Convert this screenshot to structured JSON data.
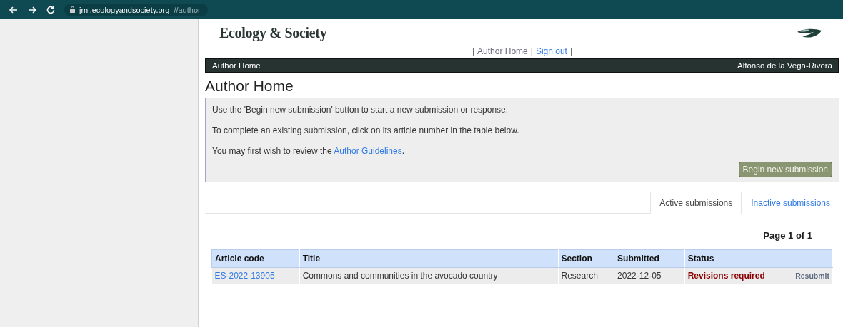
{
  "browser": {
    "url_host": "jrnl.ecologyandsociety.org",
    "url_path": "//author"
  },
  "header": {
    "logo": "Ecology & Society"
  },
  "top_links": {
    "items": [
      {
        "label": "Author Home",
        "selected": true
      },
      {
        "label": "Sign out",
        "selected": false
      }
    ],
    "separator": "|"
  },
  "nav_bar": {
    "left": "Author Home",
    "right": "Alfonso de la Vega-Rivera"
  },
  "page_title": "Author Home",
  "info_box": {
    "lines": [
      {
        "text": "Use the 'Begin new submission' button to start a new submission or response."
      },
      {
        "text": "To complete an existing submission, click on its article number in the table below."
      },
      {
        "text": "You may first wish to review the ",
        "link": "Author Guidelines",
        "after": "."
      }
    ],
    "button": "Begin new submission"
  },
  "tabs": [
    {
      "label": "Active submissions",
      "selected": true
    },
    {
      "label": "Inactive submissions",
      "selected": false
    }
  ],
  "pagination": "Page 1 of 1",
  "table": {
    "columns": [
      "Article code",
      "Title",
      "Section",
      "Submitted",
      "Status"
    ],
    "rows": [
      {
        "code": "ES-2022-13905",
        "title": "Commons and communities in the avocado country",
        "section": "Research",
        "submitted": "2022-12-05",
        "status": "Revisions required",
        "action": "Resubmit"
      }
    ]
  }
}
